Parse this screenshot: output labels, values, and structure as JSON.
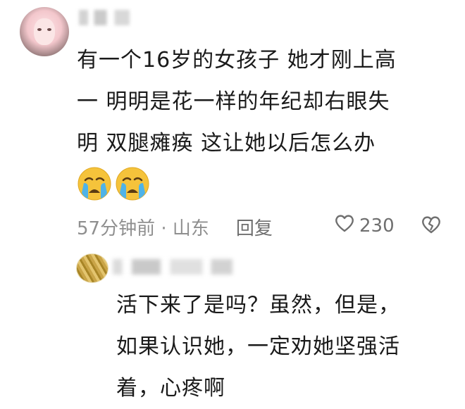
{
  "comment": {
    "text_lines": [
      "有一个16岁的女孩子 她才刚上高",
      "一 明明是花一样的年纪却右眼失",
      "明 双腿瘫痪 这让她以后怎么办"
    ],
    "emojis": [
      "crying-face",
      "crying-face"
    ],
    "time_location": "57分钟前 · 山东",
    "reply_label": "回复",
    "like_count": "230"
  },
  "reply": {
    "text_lines": [
      "活下来了是吗？虽然，但是，",
      "如果认识她，一定劝她坚强活",
      "着，心疼啊"
    ]
  },
  "colors": {
    "text": "#1a1a1a",
    "meta": "#8f8f8f",
    "emoji_face": "#f5c33b",
    "tear": "#4fb3e8"
  }
}
